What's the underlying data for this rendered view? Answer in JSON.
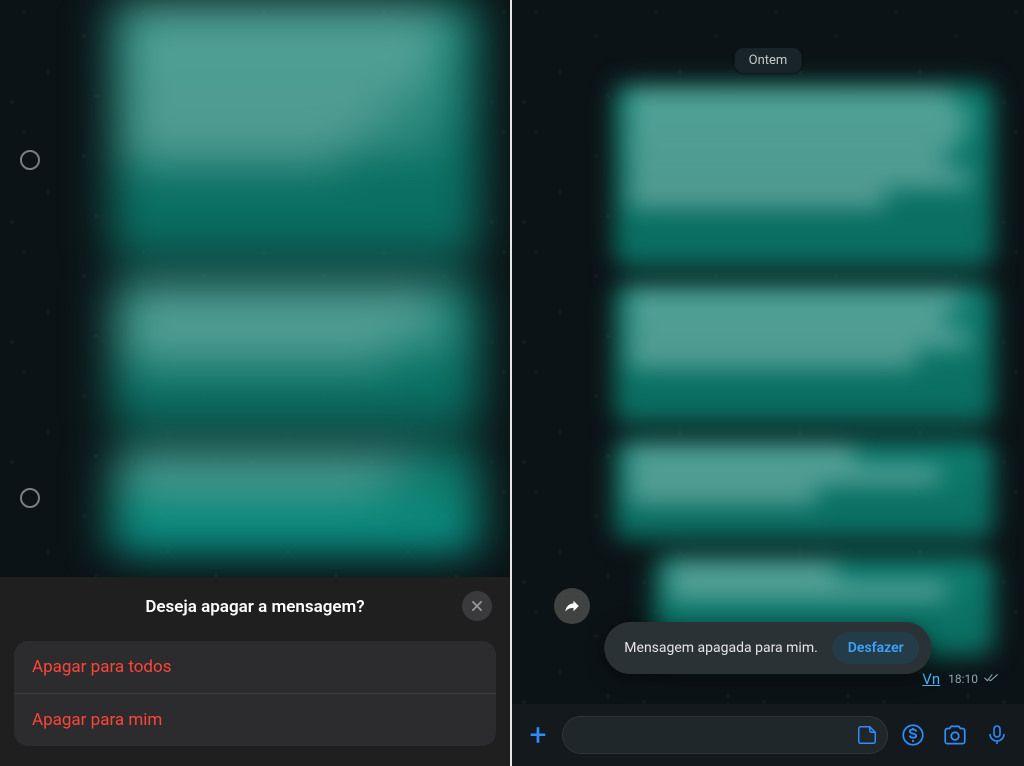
{
  "left_panel": {
    "action_sheet": {
      "title": "Deseja apagar a mensagem?",
      "close_label": "Fechar",
      "options": {
        "delete_for_everyone": "Apagar para todos",
        "delete_for_me": "Apagar para mim"
      }
    }
  },
  "right_panel": {
    "date_chip": "Ontem",
    "message_meta": {
      "vn_label": "Vn",
      "time": "18:10"
    },
    "toast": {
      "text": "Mensagem apagada para mim.",
      "undo_label": "Desfazer"
    },
    "input_bar": {
      "plus_label": "+",
      "placeholder": ""
    }
  },
  "icons": {
    "close": "close-icon",
    "forward": "forward-icon",
    "plus": "plus-icon",
    "sticker": "sticker-icon",
    "payment": "payment-icon",
    "camera": "camera-icon",
    "mic": "mic-icon",
    "double_check": "double-check-icon"
  },
  "colors": {
    "destructive": "#ff453a",
    "accent_blue": "#2f8eff",
    "bubble": "#0d7e6f"
  }
}
